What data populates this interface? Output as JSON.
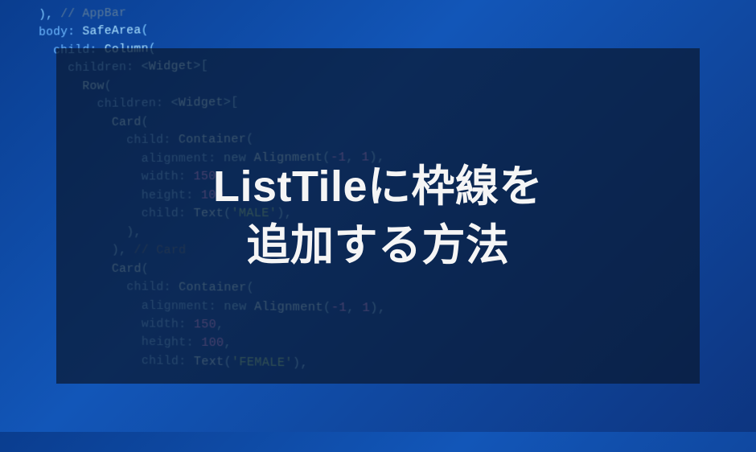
{
  "code": {
    "lines": [
      "  ), // AppBar",
      "  body: SafeArea(",
      "    child: Column(",
      "      children: <Widget>[",
      "        Row(",
      "          children: <Widget>[",
      "            Card(",
      "              child: Container(",
      "                alignment: new Alignment(-1, 1),",
      "                width: 150,",
      "                height: 100,",
      "                child: Text('MALE'),",
      "              ),",
      "            ), // Card",
      "            Card(",
      "              child: Container(",
      "                alignment: new Alignment(-1, 1),",
      "                width: 150,",
      "                height: 100,",
      "                child: Text('FEMALE'),"
    ]
  },
  "title": {
    "line1": "ListTileに枠線を",
    "line2": "追加する方法"
  }
}
